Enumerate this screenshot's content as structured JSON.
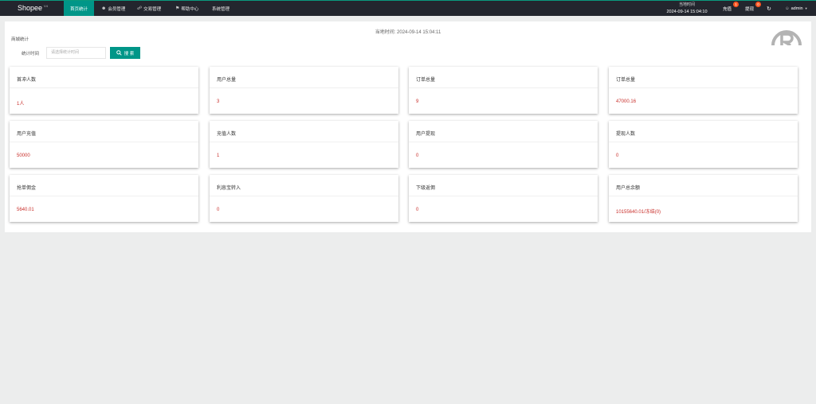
{
  "topbar": {
    "brand": "Shopee",
    "brand_sup": "V4",
    "nav": [
      {
        "label": "首页统计"
      },
      {
        "label": "会员管理"
      },
      {
        "label": "交易管理"
      },
      {
        "label": "帮助中心"
      },
      {
        "label": "系统管理"
      }
    ],
    "clock_label": "当地时间",
    "clock_value": "2024-09-14 15:04:10",
    "recharge_label": "充值",
    "recharge_badge": "1",
    "withdraw_label": "提现",
    "withdraw_badge": "0",
    "user": "admin"
  },
  "main": {
    "generated_time": "当地时间:  2024-09-14 15:04:11",
    "page_label": "商城统计",
    "form_label": "统计时间",
    "date_placeholder": "请选择统计时间",
    "search_label": "搜 索"
  },
  "cards": [
    {
      "title": "首冲人数",
      "value": "1人"
    },
    {
      "title": "用户总量",
      "value": "3"
    },
    {
      "title": "订单总量",
      "value": "9"
    },
    {
      "title": "订单总量",
      "value": "47000.16"
    },
    {
      "title": "用户充值",
      "value": "50000"
    },
    {
      "title": "充值人数",
      "value": "1"
    },
    {
      "title": "用户提现",
      "value": "0"
    },
    {
      "title": "提现人数",
      "value": "0"
    },
    {
      "title": "抢单佣金",
      "value": "5640.01"
    },
    {
      "title": "利息宝转入",
      "value": "0"
    },
    {
      "title": "下级返佣",
      "value": "0"
    },
    {
      "title": "用户总余额",
      "value": "10155640.01/冻结(0)"
    }
  ],
  "colors": {
    "accent": "#009688",
    "topbar": "#23262e",
    "value": "#c9302c",
    "badge": "#ff5722"
  }
}
